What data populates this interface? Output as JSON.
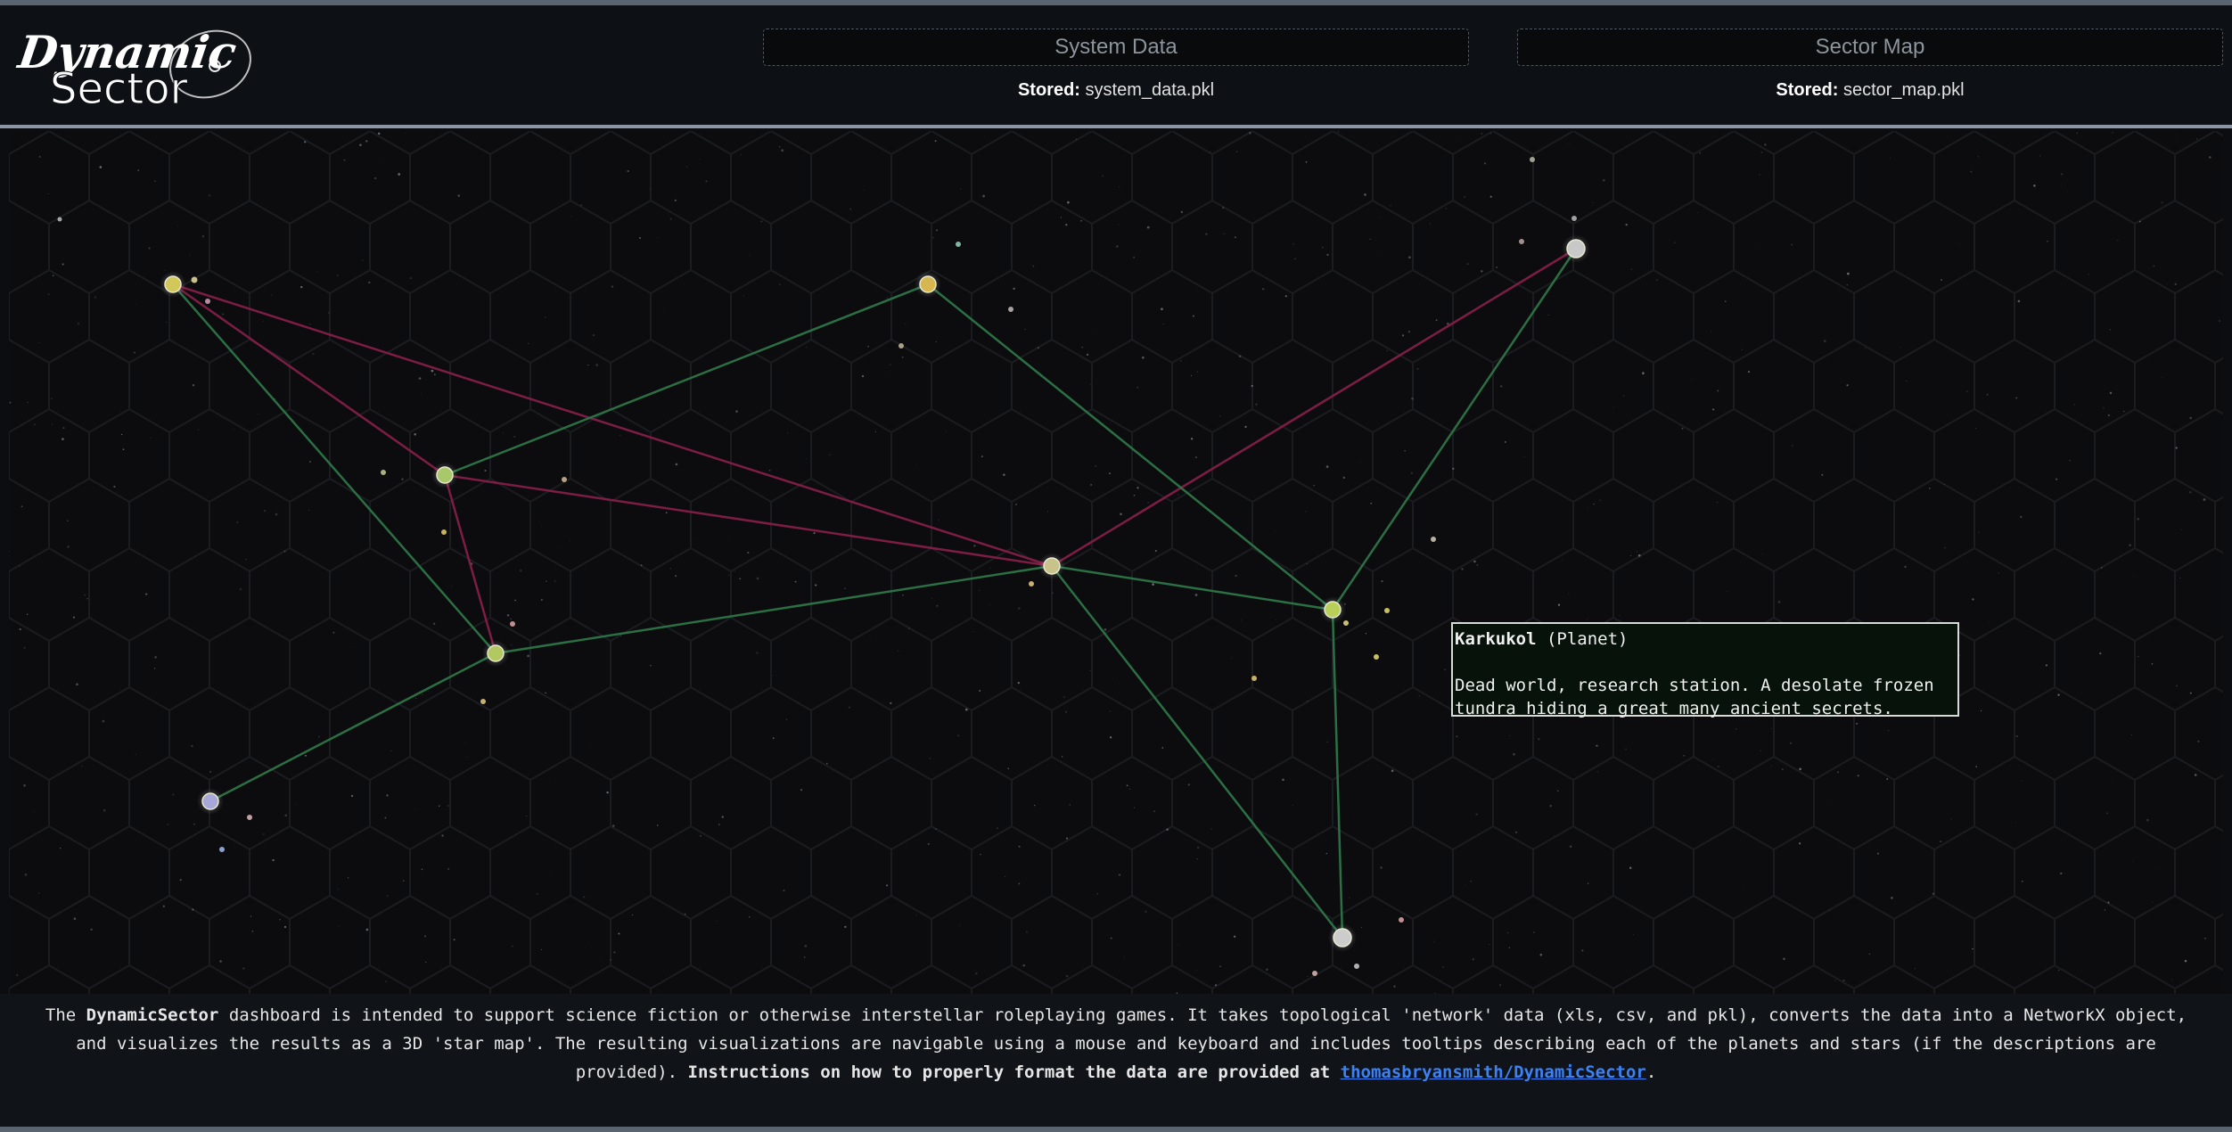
{
  "app": {
    "logo_text_top": "Dynamic",
    "logo_text_bottom": "Sector"
  },
  "header": {
    "system_upload_label": "System Data",
    "sector_upload_label": "Sector Map",
    "stored_label": "Stored:",
    "system_stored_file": "system_data.pkl",
    "sector_stored_file": "sector_map.pkl"
  },
  "tooltip": {
    "name": "Karkukol",
    "type": "(Planet)",
    "description_line1": "Dead world, research station. A desolate frozen",
    "description_line2": "tundra hiding a great many ancient secrets."
  },
  "footer": {
    "text_1": "The ",
    "brand": "DynamicSector",
    "text_2": " dashboard is intended to support science fiction or otherwise interstellar roleplaying games. It takes topological 'network' data (xls, csv, and pkl), converts the data into a NetworkX object, and visualizes the results as a 3D 'star map'. The resulting visualizations are navigable using a mouse and keyboard and includes tooltips describing each of the planets and stars (if the descriptions are provided). ",
    "instructions": "Instructions on how to properly format the data are provided at",
    "link_text": "thomasbryansmith/DynamicSector",
    "period": "."
  },
  "colors": {
    "green_edge": "#2f7a4a",
    "red_edge": "#8a1f4a",
    "star_yellow": "#c9c15a",
    "star_green": "#a8c86a",
    "star_white": "#c8c8c8",
    "star_lavender": "#a8a8d0",
    "link": "#3b82f6"
  },
  "map": {
    "nodes": [
      {
        "id": "A",
        "kind": "star",
        "color": "#d2c85a"
      },
      {
        "id": "B",
        "kind": "star",
        "color": "#d6b64e"
      },
      {
        "id": "C",
        "kind": "star",
        "color": "#c8c8c8"
      },
      {
        "id": "D",
        "kind": "star",
        "color": "#a9c86a"
      },
      {
        "id": "E",
        "kind": "star",
        "color": "#c8c38a"
      },
      {
        "id": "F",
        "kind": "star",
        "color": "#b8d05a"
      },
      {
        "id": "G",
        "kind": "star",
        "color": "#b2c860"
      },
      {
        "id": "H",
        "kind": "star",
        "color": "#a8a8d8"
      },
      {
        "id": "I",
        "kind": "star",
        "color": "#cccccc"
      }
    ],
    "edges": [
      {
        "from": "A",
        "to": "E",
        "kind": "red"
      },
      {
        "from": "A",
        "to": "D",
        "kind": "red"
      },
      {
        "from": "D",
        "to": "G",
        "kind": "red"
      },
      {
        "from": "D",
        "to": "E",
        "kind": "red"
      },
      {
        "from": "E",
        "to": "C",
        "kind": "red"
      },
      {
        "from": "A",
        "to": "G",
        "kind": "green"
      },
      {
        "from": "D",
        "to": "B",
        "kind": "green"
      },
      {
        "from": "B",
        "to": "F",
        "kind": "green"
      },
      {
        "from": "G",
        "to": "E",
        "kind": "green"
      },
      {
        "from": "E",
        "to": "F",
        "kind": "green"
      },
      {
        "from": "F",
        "to": "C",
        "kind": "green"
      },
      {
        "from": "G",
        "to": "H",
        "kind": "green"
      },
      {
        "from": "E",
        "to": "I",
        "kind": "green"
      },
      {
        "from": "F",
        "to": "I",
        "kind": "green"
      }
    ]
  }
}
